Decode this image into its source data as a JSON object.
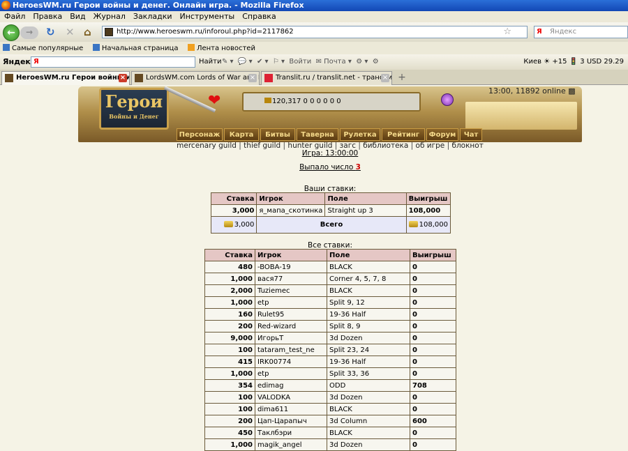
{
  "window": {
    "title": "HeroesWM.ru Герои войны и денег. Онлайн игра. - Mozilla Firefox"
  },
  "menu": [
    "Файл",
    "Правка",
    "Вид",
    "Журнал",
    "Закладки",
    "Инструменты",
    "Справка"
  ],
  "nav": {
    "url": "http://www.heroeswm.ru/inforoul.php?id=2117862",
    "search_placeholder": "Яндекс"
  },
  "bookmarks": [
    "Самые популярные",
    "Начальная страница",
    "Лента новостей"
  ],
  "yandex": {
    "logo": "Яндекс",
    "input": "Я",
    "find": "Найти",
    "login": "Войти",
    "mail": "Почта",
    "info": "Киев ☀ +15 🚦 3  USD 29.29"
  },
  "tabs": [
    {
      "label": "HeroesWM.ru Герои войны и де..."
    },
    {
      "label": "LordsWM.com Lords of War and Money..."
    },
    {
      "label": "Translit.ru / translit.net - транслитераци..."
    }
  ],
  "header": {
    "online": "13:00, 11892 online",
    "logo": "Герои",
    "logo_sub": "Войны и Денег",
    "resources": "120,317  0  0  0  0  0  0"
  },
  "game_menu": [
    "Персонаж",
    "Карта",
    "Битвы",
    "Таверна",
    "Рулетка",
    "Рейтинг",
    "Форум",
    "Чат"
  ],
  "links": [
    "mercenary guild",
    "thief guild",
    "hunter guild",
    "загс",
    "библиотека",
    "об игре",
    "блокнот"
  ],
  "game_time": "Игра: 13:00:00",
  "result": {
    "text": "Выпало число ",
    "number": "3"
  },
  "my_bets": {
    "caption": "Ваши ставки:",
    "headers": [
      "Ставка",
      "Игрок",
      "Поле",
      "Выигрыш"
    ],
    "rows": [
      [
        "3,000",
        "я_мапа_скотинка",
        "Straight up 3",
        "108,000"
      ]
    ],
    "total": {
      "bet": "3,000",
      "label": "Всего",
      "win": "108,000"
    }
  },
  "all_bets": {
    "caption": "Все ставки:",
    "headers": [
      "Ставка",
      "Игрок",
      "Поле",
      "Выигрыш"
    ],
    "rows": [
      [
        "480",
        "-BOBA-19",
        "BLACK",
        "0"
      ],
      [
        "1,000",
        "вася77",
        "Corner 4, 5, 7, 8",
        "0"
      ],
      [
        "2,000",
        "Tuziemec",
        "BLACK",
        "0"
      ],
      [
        "1,000",
        "etp",
        "Split 9, 12",
        "0"
      ],
      [
        "160",
        "Rulet95",
        "19-36 Half",
        "0"
      ],
      [
        "200",
        "Red-wizard",
        "Split 8, 9",
        "0"
      ],
      [
        "9,000",
        "ИгорьТ",
        "3d Dozen",
        "0"
      ],
      [
        "100",
        "tataram_test_ne",
        "Split 23, 24",
        "0"
      ],
      [
        "415",
        "IRK00774",
        "19-36 Half",
        "0"
      ],
      [
        "1,000",
        "etp",
        "Split 33, 36",
        "0"
      ],
      [
        "354",
        "edimag",
        "ODD",
        "708"
      ],
      [
        "100",
        "VALODKA",
        "3d Dozen",
        "0"
      ],
      [
        "100",
        "dima611",
        "BLACK",
        "0"
      ],
      [
        "200",
        "Цап-Царапыч",
        "3d Column",
        "600"
      ],
      [
        "450",
        "Таклбэри",
        "BLACK",
        "0"
      ],
      [
        "1,000",
        "magik_angel",
        "3d Dozen",
        "0"
      ]
    ]
  }
}
